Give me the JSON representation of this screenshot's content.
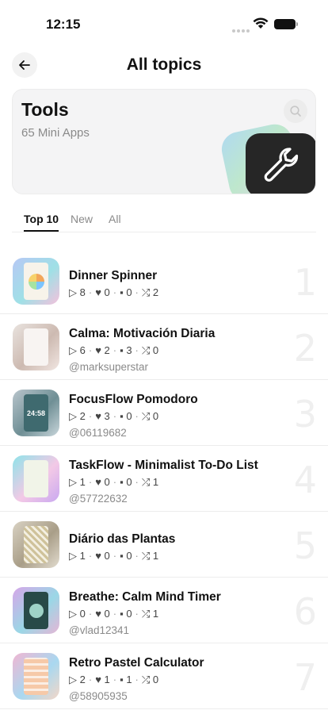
{
  "status": {
    "time": "12:15"
  },
  "nav": {
    "title": "All topics"
  },
  "topic": {
    "title": "Tools",
    "subtitle": "65 Mini Apps"
  },
  "tabs": [
    {
      "label": "Top 10",
      "active": true
    },
    {
      "label": "New",
      "active": false
    },
    {
      "label": "All",
      "active": false
    }
  ],
  "items": [
    {
      "title": "Dinner Spinner",
      "stats": [
        "▷ 8",
        "♥ 0",
        "▪ 0",
        "⤮ 2"
      ],
      "author": "",
      "rank": "1"
    },
    {
      "title": "Calma: Motivación Diaria",
      "stats": [
        "▷ 6",
        "♥ 2",
        "▪ 3",
        "⤮ 0"
      ],
      "author": "@marksuperstar",
      "rank": "2"
    },
    {
      "title": "FocusFlow Pomodoro",
      "stats": [
        "▷ 2",
        "♥ 3",
        "▪ 0",
        "⤮ 0"
      ],
      "author": "@06119682",
      "rank": "3"
    },
    {
      "title": "TaskFlow - Minimalist To-Do List",
      "stats": [
        "▷ 1",
        "♥ 0",
        "▪ 0",
        "⤮ 1"
      ],
      "author": "@57722632",
      "rank": "4"
    },
    {
      "title": "Diário das Plantas",
      "stats": [
        "▷ 1",
        "♥ 0",
        "▪ 0",
        "⤮ 1"
      ],
      "author": "",
      "rank": "5"
    },
    {
      "title": "Breathe: Calm Mind Timer",
      "stats": [
        "▷ 0",
        "♥ 0",
        "▪ 0",
        "⤮ 1"
      ],
      "author": "@vlad12341",
      "rank": "6"
    },
    {
      "title": "Retro Pastel Calculator",
      "stats": [
        "▷ 2",
        "♥ 1",
        "▪ 1",
        "⤮ 0"
      ],
      "author": "@58905935",
      "rank": "7"
    }
  ]
}
